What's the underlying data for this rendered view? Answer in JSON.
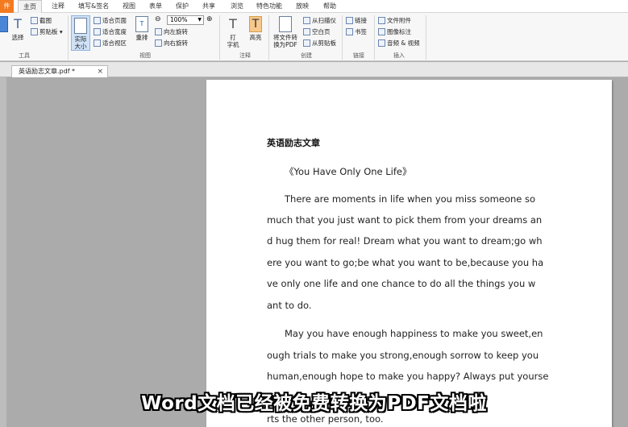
{
  "menu": {
    "file": "件",
    "items": [
      "主页",
      "注释",
      "填写&签名",
      "视图",
      "表单",
      "保护",
      "共享",
      "浏览",
      "特色功能",
      "放映",
      "帮助"
    ]
  },
  "ribbon": {
    "tools": {
      "select": "选择",
      "screenshot": "截图",
      "clipboard": "剪贴板",
      "label": "工具"
    },
    "view": {
      "actual_size": "实际\n大小",
      "fit_page": "适合页面",
      "fit_width": "适合宽度",
      "fit_visible": "适合视区",
      "reflow": "重排",
      "zoom_value": "100%",
      "rotate_left": "向左旋转",
      "rotate_right": "向右旋转",
      "label": "视图"
    },
    "annotation": {
      "typewriter": "打\n字机",
      "highlight": "高亮",
      "label": "注释"
    },
    "create": {
      "convert": "将文件转\n换为PDF",
      "from_scanner": "从扫描仪",
      "blank_page": "空白页",
      "from_clipboard": "从剪贴板",
      "label": "创建"
    },
    "link": {
      "link": "链接",
      "bookmark": "书签",
      "label": "链接"
    },
    "insert": {
      "attachment": "文件附件",
      "image_annot": "图像标注",
      "audio_video": "音频 & 视频",
      "label": "插入"
    }
  },
  "tab": {
    "name": "英语励志文章.pdf *",
    "close": "×"
  },
  "document": {
    "title": "英语励志文章",
    "subtitle": "《You Have Only One Life》",
    "lines": [
      "There are moments in life when you miss someone so",
      "much that you just want to pick them from your dreams an",
      "d hug them for real! Dream what you want to dream;go wh",
      "ere you want to go;be what you want to be,because you ha",
      "ve only one life and one chance to do all the things you w",
      "ant to do.",
      "May you have enough happiness to make you sweet,en",
      "ough trials to make you strong,enough sorrow to keep you",
      "human,enough hope to make you happy? Always put yourse",
      "rts the other person, too."
    ]
  },
  "overlay_caption": "Word文档已经被免费转换为PDF文档啦",
  "colors": {
    "accent": "#f47a20",
    "page_bg": "#ababab",
    "highlight_btn": "#f6c88a"
  }
}
